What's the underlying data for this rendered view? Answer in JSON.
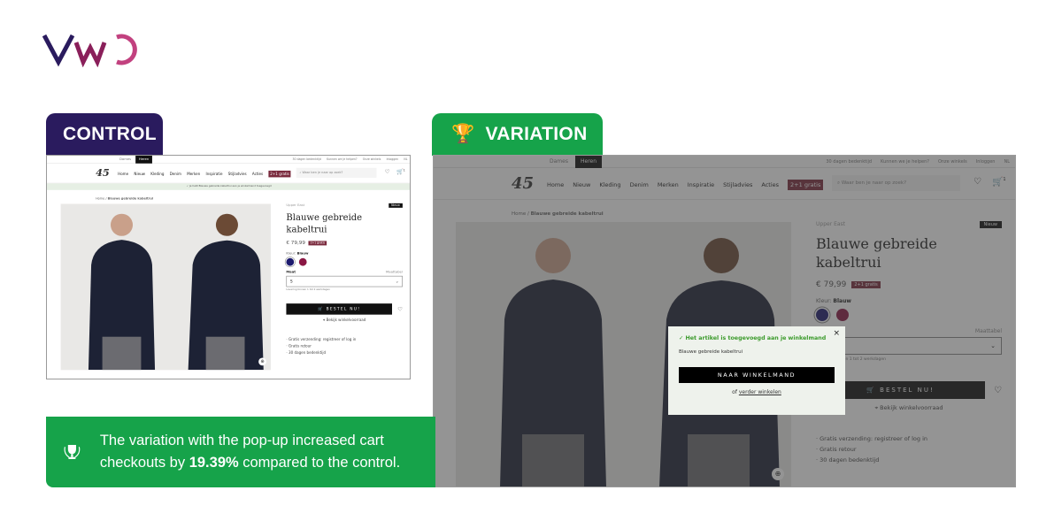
{
  "brand": {
    "logo_text": "VWO",
    "colors": {
      "v": "#2a1b5e",
      "w": "#8a1f5a",
      "o": "#c2417f"
    }
  },
  "control": {
    "label": "CONTROL",
    "color": "#2a1b5e"
  },
  "variation": {
    "label": "VARIATION",
    "color": "#16a34a",
    "icon": "trophy-icon"
  },
  "result": {
    "text_before": "The variation with the pop-up increased cart checkouts by ",
    "highlight": "19.39%",
    "text_after": " compared to the control.",
    "icon": "trophy-icon"
  },
  "store": {
    "gender_tabs": [
      "Dames",
      "Heren"
    ],
    "top_links": [
      "30 dagen bedenktijd",
      "Kunnen we je helpen?",
      "Onze winkels",
      "Inloggen",
      "NL"
    ],
    "logo": "45",
    "nav": [
      "Home",
      "Nieuw",
      "Kleding",
      "Denim",
      "Merken",
      "Inspiratie",
      "Stijladvies",
      "Acties"
    ],
    "promo": "2+1 gratis",
    "search_placeholder": "Waar ben je naar op zoek?",
    "cart_count": "1",
    "added_strip": "✓ Je hebt Blauwe gebreide kabeltrui aan je winkelmand toegevoegd",
    "breadcrumb": [
      "Home",
      "Blauwe gebreide kabeltrui"
    ],
    "product": {
      "brand": "Upper East",
      "badge": "Nieuw",
      "title": "Blauwe gebreide kabeltrui",
      "price": "€ 79,99",
      "price_badge": "2+1 gratis",
      "color_label": "Kleur:",
      "color_value": "Blauw",
      "swatches": [
        "#1c1a6e",
        "#8a1744"
      ],
      "size_label": "Maat",
      "size_chart": "Maattabel",
      "size_value": "S",
      "delivery": "Levering binnen 1 tot 2 werkdagen",
      "buy": "BESTEL NU!",
      "store_stock": "Bekijk winkelvoorraad",
      "usps": [
        "Gratis verzending: registreer of log in",
        "Gratis retour",
        "30 dagen bedenktijd"
      ]
    }
  },
  "popup": {
    "message": "Het artikel is toegevoegd aan je winkelmand",
    "product": "Blauwe gebreide kabeltrui",
    "button": "NAAR WINKELMAND",
    "or": "of ",
    "continue": "verder winkelen"
  }
}
